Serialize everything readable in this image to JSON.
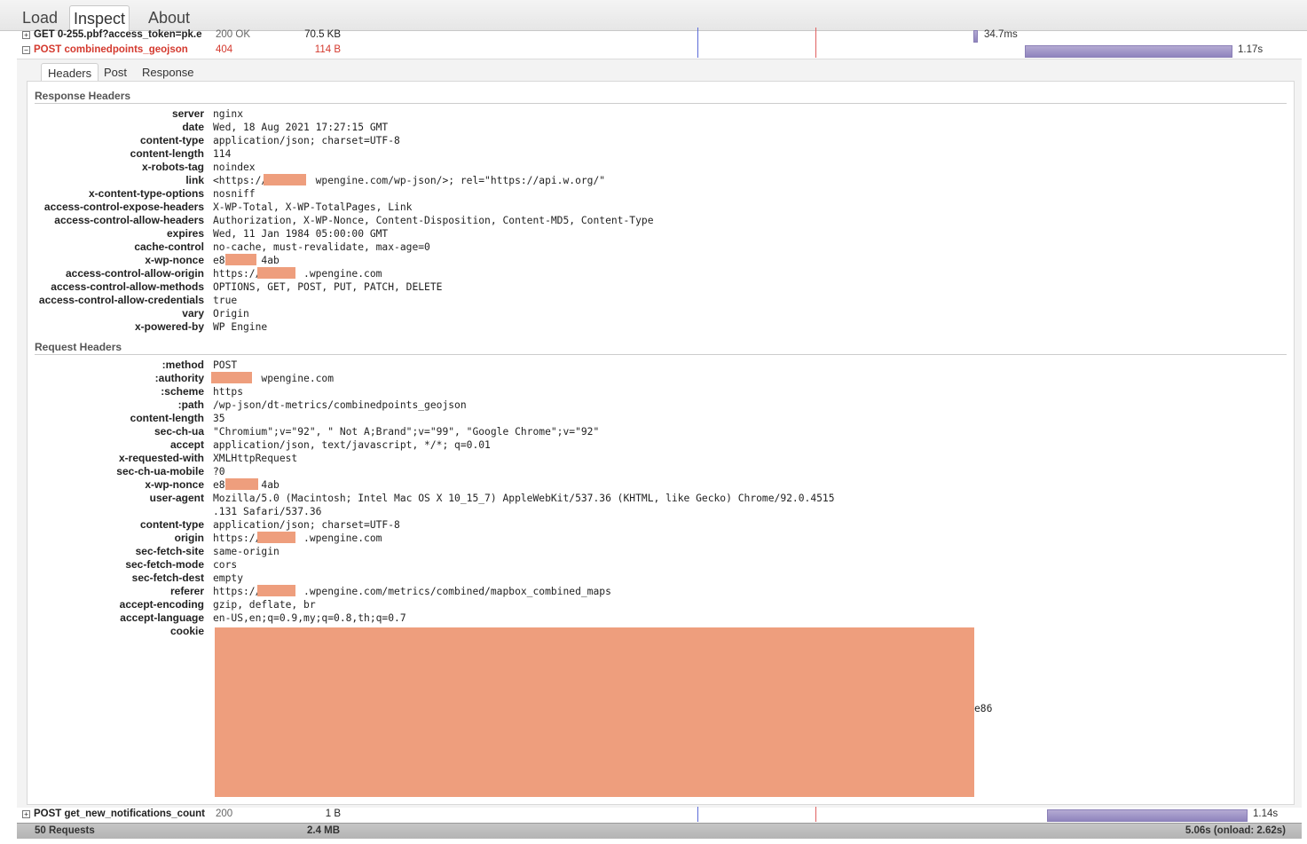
{
  "tabs": {
    "load": "Load",
    "inspect": "Inspect",
    "about": "About"
  },
  "requests": {
    "r1": {
      "name": "GET 0-255.pbf?access_token=pk.e",
      "status": "200 OK",
      "size": "70.5 KB",
      "time": "34.7ms"
    },
    "r2": {
      "name": "POST combinedpoints_geojson",
      "status": "404",
      "size": "114 B",
      "time": "1.17s"
    },
    "r3": {
      "name": "POST get_new_notifications_count",
      "status": "200",
      "size": "1 B",
      "time": "1.14s"
    }
  },
  "detail_tabs": {
    "headers": "Headers",
    "post": "Post",
    "response": "Response"
  },
  "response_headers": {
    "title": "Response Headers",
    "rows": [
      {
        "k": "server",
        "v": "nginx"
      },
      {
        "k": "date",
        "v": "Wed, 18 Aug 2021 17:27:15 GMT"
      },
      {
        "k": "content-type",
        "v": "application/json; charset=UTF-8"
      },
      {
        "k": "content-length",
        "v": "114"
      },
      {
        "k": "x-robots-tag",
        "v": "noindex"
      },
      {
        "k": "link",
        "v": "<https://        wpengine.com/wp-json/>; rel=\"https://api.w.org/\""
      },
      {
        "k": "x-content-type-options",
        "v": "nosniff"
      },
      {
        "k": "access-control-expose-headers",
        "v": "X-WP-Total, X-WP-TotalPages, Link"
      },
      {
        "k": "access-control-allow-headers",
        "v": "Authorization, X-WP-Nonce, Content-Disposition, Content-MD5, Content-Type"
      },
      {
        "k": "expires",
        "v": "Wed, 11 Jan 1984 05:00:00 GMT"
      },
      {
        "k": "cache-control",
        "v": "no-cache, must-revalidate, max-age=0"
      },
      {
        "k": "x-wp-nonce",
        "v": "e8      4ab"
      },
      {
        "k": "access-control-allow-origin",
        "v": "https://       .wpengine.com"
      },
      {
        "k": "access-control-allow-methods",
        "v": "OPTIONS, GET, POST, PUT, PATCH, DELETE"
      },
      {
        "k": "access-control-allow-credentials",
        "v": "true"
      },
      {
        "k": "vary",
        "v": "Origin"
      },
      {
        "k": "x-powered-by",
        "v": "WP Engine"
      }
    ]
  },
  "request_headers": {
    "title": "Request Headers",
    "rows": [
      {
        "k": ":method",
        "v": "POST"
      },
      {
        "k": ":authority",
        "v": "        wpengine.com"
      },
      {
        "k": ":scheme",
        "v": "https"
      },
      {
        "k": ":path",
        "v": "/wp-json/dt-metrics/combinedpoints_geojson"
      },
      {
        "k": "content-length",
        "v": "35"
      },
      {
        "k": "sec-ch-ua",
        "v": "\"Chromium\";v=\"92\", \" Not A;Brand\";v=\"99\", \"Google Chrome\";v=\"92\""
      },
      {
        "k": "accept",
        "v": "application/json, text/javascript, */*; q=0.01"
      },
      {
        "k": "x-requested-with",
        "v": "XMLHttpRequest"
      },
      {
        "k": "sec-ch-ua-mobile",
        "v": "?0"
      },
      {
        "k": "x-wp-nonce",
        "v": "e8      4ab"
      },
      {
        "k": "user-agent",
        "v": "Mozilla/5.0 (Macintosh; Intel Mac OS X 10_15_7) AppleWebKit/537.36 (KHTML, like Gecko) Chrome/92.0.4515"
      },
      {
        "k": "",
        "v": ".131 Safari/537.36"
      },
      {
        "k": "content-type",
        "v": "application/json; charset=UTF-8"
      },
      {
        "k": "origin",
        "v": "https://       .wpengine.com"
      },
      {
        "k": "sec-fetch-site",
        "v": "same-origin"
      },
      {
        "k": "sec-fetch-mode",
        "v": "cors"
      },
      {
        "k": "sec-fetch-dest",
        "v": "empty"
      },
      {
        "k": "referer",
        "v": "https://       .wpengine.com/metrics/combined/mapbox_combined_maps"
      },
      {
        "k": "accept-encoding",
        "v": "gzip, deflate, br"
      },
      {
        "k": "accept-language",
        "v": "en-US,en;q=0.9,my;q=0.8,th;q=0.7"
      },
      {
        "k": "cookie",
        "v": ""
      }
    ],
    "cookie_tail": "e86"
  },
  "footer": {
    "requests": "50 Requests",
    "size": "2.4 MB",
    "timing": "5.06s (onload: 2.62s)"
  },
  "colors": {
    "error": "#d43a2f",
    "redaction": "#ee9e7d",
    "bar": "#9d93c6"
  }
}
